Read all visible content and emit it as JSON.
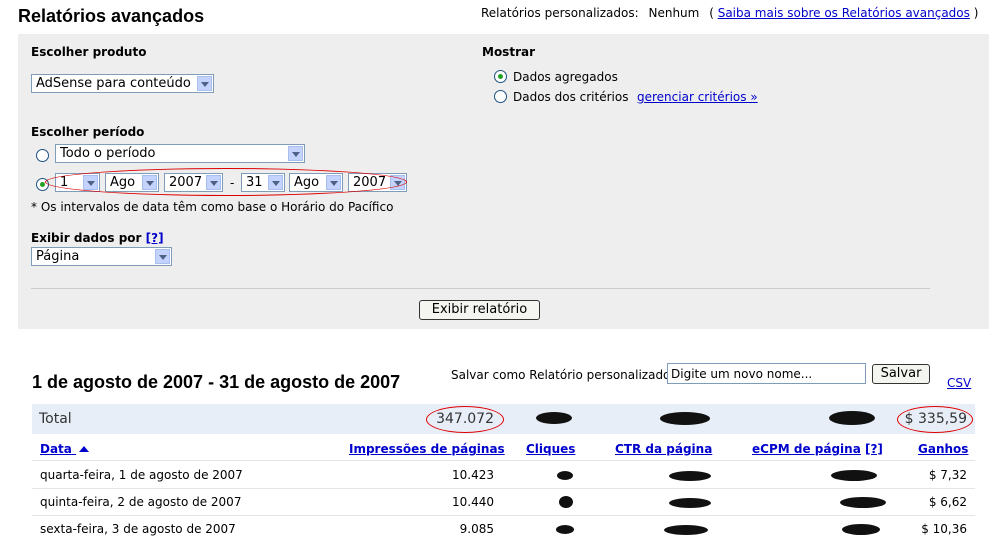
{
  "page": {
    "title": "Relatórios avançados",
    "custom_label": "Relatórios personalizados:",
    "custom_value": "Nenhum",
    "learn_more_open": "(",
    "learn_more_link": "Saiba mais sobre os Relatórios avançados",
    "learn_more_close": ")"
  },
  "form": {
    "product_label": "Escolher produto",
    "product_value": "AdSense para conteúdo",
    "show_label": "Mostrar",
    "show_option1": "Dados agregados",
    "show_option2": "Dados dos critérios",
    "manage_criteria": "gerenciar critérios »",
    "period_label": "Escolher período",
    "period_all": "Todo o período",
    "from_day": "1",
    "from_month": "Ago",
    "from_year": "2007",
    "range_sep": "-",
    "to_day": "31",
    "to_month": "Ago",
    "to_year": "2007",
    "tz_note": "* Os intervalos de data têm como base o Horário do Pacífico",
    "display_by_label": "Exibir dados por",
    "help_bracket": "[?]",
    "display_by_value": "Página",
    "submit": "Exibir relatório"
  },
  "report": {
    "range_title": "1 de agosto de 2007 - 31 de agosto de 2007",
    "save_label": "Salvar como Relatório personalizado:",
    "save_placeholder": "Digite um novo nome...",
    "save_button": "Salvar",
    "csv": "CSV",
    "total_label": "Total",
    "total_impressions": "347.072",
    "total_earnings": "$ 335,59",
    "headers": {
      "date": "Data",
      "impressions": "Impressões de páginas",
      "clicks": "Cliques",
      "ctr": "CTR da página",
      "ecpm": "eCPM de página",
      "ecpm_help": "[?]",
      "earnings": "Ganhos"
    },
    "rows": [
      {
        "date": "quarta-feira, 1 de agosto de 2007",
        "impressions": "10.423",
        "earnings": "$ 7,32"
      },
      {
        "date": "quinta-feira, 2 de agosto de 2007",
        "impressions": "10.440",
        "earnings": "$ 6,62"
      },
      {
        "date": "sexta-feira, 3 de agosto de 2007",
        "impressions": "9.085",
        "earnings": "$ 10,36"
      }
    ]
  },
  "colors": {
    "link": "#0000cc",
    "panel": "#eeeeee",
    "annotation": "#dd0000"
  }
}
